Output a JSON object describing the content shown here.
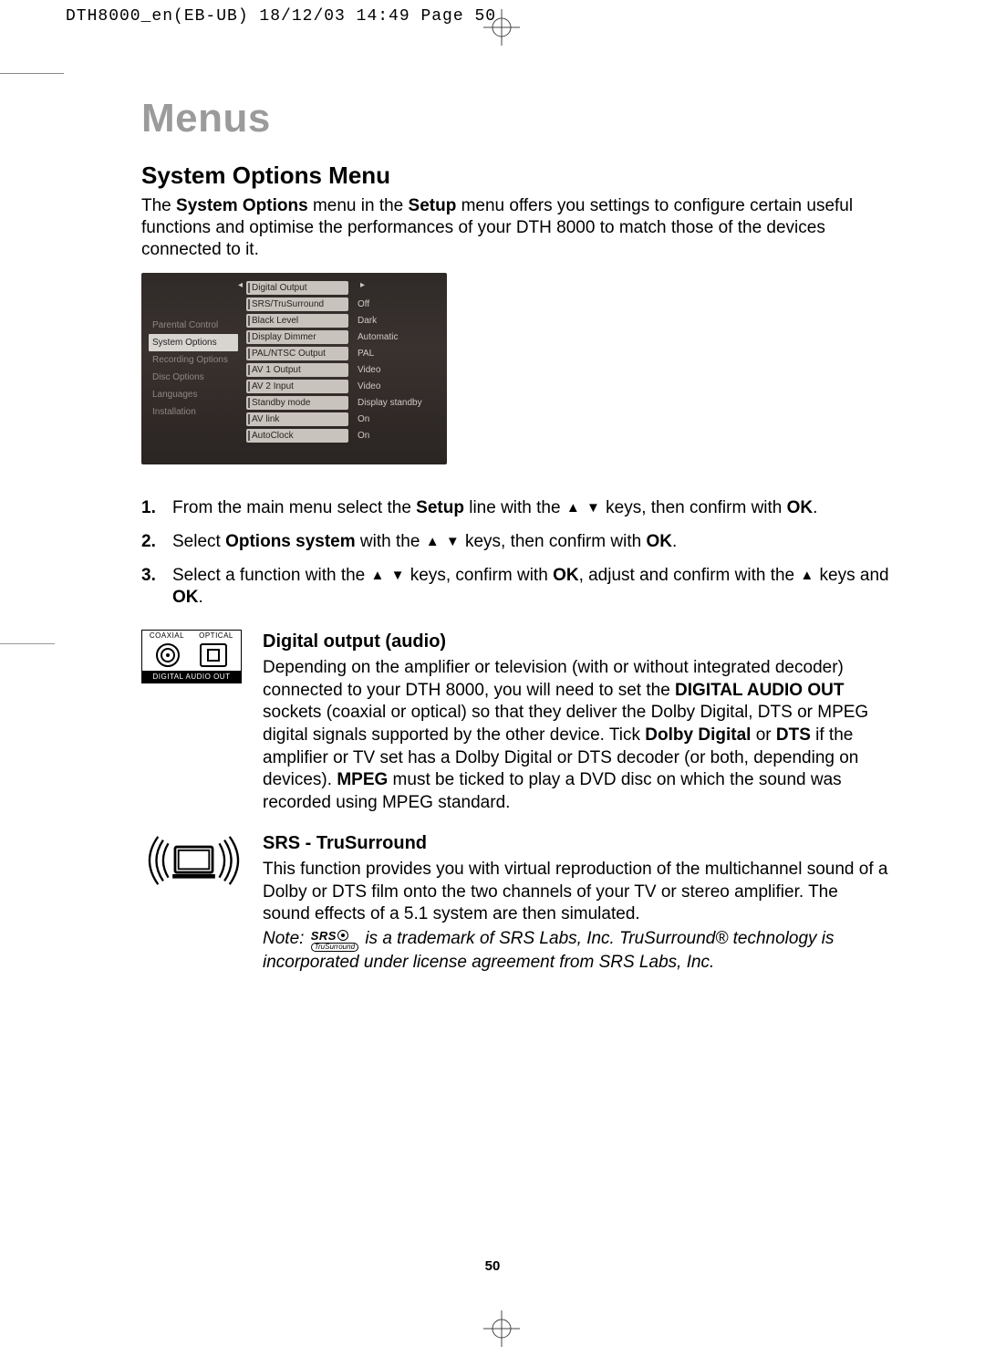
{
  "slug": "DTH8000_en(EB-UB)  18/12/03  14:49  Page 50",
  "title": "Menus",
  "section_title": "System Options Menu",
  "intro_pre": "The ",
  "intro_b1": "System Options",
  "intro_mid1": " menu in the ",
  "intro_b2": "Setup",
  "intro_post": " menu offers you settings to configure certain useful functions and optimise the performances of your DTH 8000 to match those of the devices connected to it.",
  "screenshot": {
    "left_items": [
      {
        "label": "Parental Control",
        "selected": false
      },
      {
        "label": "System Options",
        "selected": true
      },
      {
        "label": "Recording Options",
        "selected": false
      },
      {
        "label": "Disc Options",
        "selected": false
      },
      {
        "label": "Languages",
        "selected": false
      },
      {
        "label": "Installation",
        "selected": false
      }
    ],
    "right_rows": [
      {
        "label": "Digital Output",
        "value": ""
      },
      {
        "label": "SRS/TruSurround",
        "value": "Off"
      },
      {
        "label": "Black Level",
        "value": "Dark"
      },
      {
        "label": "Display Dimmer",
        "value": "Automatic"
      },
      {
        "label": "PAL/NTSC Output",
        "value": "PAL"
      },
      {
        "label": "AV 1 Output",
        "value": "Video"
      },
      {
        "label": "AV 2 Input",
        "value": "Video"
      },
      {
        "label": "Standby mode",
        "value": "Display standby"
      },
      {
        "label": "AV link",
        "value": "On"
      },
      {
        "label": "AutoClock",
        "value": "On"
      }
    ]
  },
  "steps": {
    "s1_num": "1.",
    "s1_a": "From the main menu select the ",
    "s1_b": "Setup",
    "s1_c": " line with the ",
    "s1_d": " keys, then confirm with ",
    "s1_e": "OK",
    "s1_f": ".",
    "s2_num": "2.",
    "s2_a": "Select ",
    "s2_b": "Options system",
    "s2_c": " with the ",
    "s2_d": " keys, then confirm with ",
    "s2_e": "OK",
    "s2_f": ".",
    "s3_num": "3.",
    "s3_a": "Select a function with the ",
    "s3_b": " keys, confirm with ",
    "s3_c": "OK",
    "s3_d": ", adjust and confirm with the ",
    "s3_e": " keys and ",
    "s3_f": "OK",
    "s3_g": "."
  },
  "dao": {
    "coaxial": "COAXIAL",
    "optical": "OPTICAL",
    "label": "DIGITAL AUDIO OUT"
  },
  "digital": {
    "title": "Digital output (audio)",
    "p1": "Depending on the amplifier or television (with or without integrated decoder) connected to your DTH 8000, you will need to set the ",
    "b1": "DIGITAL AUDIO OUT",
    "p2": " sockets (coaxial or optical) so that they deliver the Dolby Digital, DTS or MPEG digital signals supported by the other device. Tick ",
    "b2": "Dolby Digital",
    "p3": " or ",
    "b3": "DTS",
    "p4": " if the amplifier or TV set has a Dolby Digital or DTS decoder (or both, depending on devices). ",
    "b4": "MPEG",
    "p5": " must be ticked to play a DVD disc on which the sound was recorded using MPEG standard."
  },
  "srs": {
    "title": "SRS - TruSurround",
    "body": "This function provides you with virtual reproduction of the multichannel sound of a Dolby or DTS film onto the two channels of your TV or stereo amplifier. The sound effects of a 5.1 system are then simulated.",
    "note_a": "Note: ",
    "note_b": " is a trademark of SRS Labs, Inc. TruSurround® technology is incorporated under license agreement from SRS Labs, Inc.",
    "logo_top": "SRS",
    "logo_bottom": "TruSurround"
  },
  "page_number": "50"
}
